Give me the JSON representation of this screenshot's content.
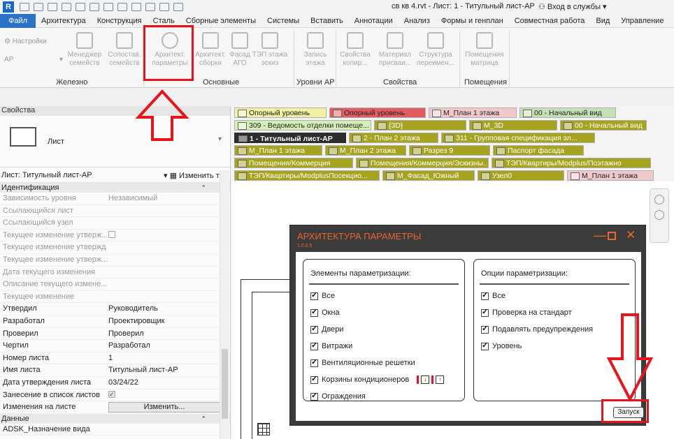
{
  "window": {
    "app_logo": "R",
    "title": "св кв 4.rvt - Лист: 1 - Титульный лист-АР",
    "signin": "Вход в службы"
  },
  "ribbon_tabs": [
    "Файл",
    "Архитектура",
    "Конструкция",
    "Сталь",
    "Сборные элементы",
    "Системы",
    "Вставить",
    "Аннотации",
    "Анализ",
    "Формы и генплан",
    "Совместная работа",
    "Вид",
    "Управление"
  ],
  "ribbon": {
    "settings_label": "Настройки",
    "ap_dropdown": "АР",
    "buttons": [
      {
        "line1": "Менеджер",
        "line2": "семейств"
      },
      {
        "line1": "Сопостав.",
        "line2": "семейств"
      },
      {
        "line1": "Архитект.",
        "line2": "параметры"
      },
      {
        "line1": "Архитект.",
        "line2": "сборки"
      },
      {
        "line1": "Фасад",
        "line2": "АГО"
      },
      {
        "line1": "ТЭП этажа",
        "line2": "эскиз"
      },
      {
        "line1": "Запись",
        "line2": "этажа"
      },
      {
        "line1": "Свойства",
        "line2": "копир..."
      },
      {
        "line1": "Материал",
        "line2": "присваи..."
      },
      {
        "line1": "Структура",
        "line2": "переимен..."
      },
      {
        "line1": "Помещения",
        "line2": "матрица"
      }
    ],
    "panels": [
      "Железно",
      "Основные",
      "Уровни АР",
      "Свойства",
      "Помещения"
    ]
  },
  "properties": {
    "title": "Свойства",
    "type_name": "Лист",
    "instance_label": "Лист: Титульный лист-АР",
    "edit_type": "Изменить тип",
    "cat_identity": "Идентификация",
    "cat_data": "Данные",
    "rows": [
      {
        "name": "Зависимость уровня",
        "value": "Независимый",
        "disabled": true
      },
      {
        "name": "Ссылающийся лист",
        "value": "",
        "disabled": true
      },
      {
        "name": "Ссылающийся узел",
        "value": "",
        "disabled": true
      },
      {
        "name": "Текущее изменение утверж...",
        "value": "",
        "disabled": true,
        "checkbox": true
      },
      {
        "name": "Текущее изменение утвержд...",
        "value": "",
        "disabled": true
      },
      {
        "name": "Текущее изменение утверж...",
        "value": "",
        "disabled": true
      },
      {
        "name": "Дата текущего изменения",
        "value": "",
        "disabled": true
      },
      {
        "name": "Описание текущего измене...",
        "value": "",
        "disabled": true
      },
      {
        "name": "Текущее изменение",
        "value": "",
        "disabled": true
      },
      {
        "name": "Утвердил",
        "value": "Руководитель",
        "disabled": false
      },
      {
        "name": "Разработал",
        "value": "Проектировщик",
        "disabled": false
      },
      {
        "name": "Проверил",
        "value": "Проверил",
        "disabled": false
      },
      {
        "name": "Чертил",
        "value": "Разработал",
        "disabled": false
      },
      {
        "name": "Номер листа",
        "value": "1",
        "disabled": false
      },
      {
        "name": "Имя листа",
        "value": "Титульный лист-АР",
        "disabled": false
      },
      {
        "name": "Дата утверждения листа",
        "value": "03/24/22",
        "disabled": false
      },
      {
        "name": "Занесение в список листов",
        "value": "",
        "disabled": false,
        "checkbox": true
      },
      {
        "name": "Изменения на листе",
        "value": "Изменить...",
        "disabled": false,
        "button": true
      }
    ],
    "data_rows": [
      {
        "name": "ADSK_Назначение вида",
        "value": ""
      }
    ]
  },
  "view_tabs": [
    "Опорный уровень",
    "Опорный уровень",
    "М_План 1 этажа",
    "00 - Начальный вид",
    "309 - Ведомость отделки помеще...",
    "{3D}",
    "М_3D",
    "00 - Начальный вид",
    "1 - Титульный лист-АР",
    "2 - План 2 этажа",
    "311 - Групповая спецификация эл...",
    "М_План 1 этажа",
    "М_План 2 этажа",
    "Разрез 9",
    "Паспорт фасада",
    "Помещения/Коммерция",
    "Помещения/Коммерция/Эскизны...",
    "ТЭП/Квартиры/Modplus/Поэтажно",
    "ТЭП/Квартиры/ModplusПосекцио...",
    "М_Фасад_Южный",
    "Узел0",
    "М_План 1 этажа"
  ],
  "dialog": {
    "title": "АРХИТЕКТУРА ПАРАМЕТРЫ",
    "version": "1.0.0.5",
    "left_title": "Элементы параметризации:",
    "left_items": [
      "Все",
      "Окна",
      "Двери",
      "Витражи",
      "Вентиляционные решетки",
      "Корзины кондиционеров",
      "Ограждения"
    ],
    "right_title": "Опции параметризации:",
    "right_items": [
      "Все",
      "Проверка на стандарт",
      "Подавлять предупреждения",
      "Уровень"
    ],
    "run_label": "Запуск"
  },
  "colors": {
    "annotation_red": "#e8131b",
    "dialog_accent": "#e9672d",
    "view_tab_olive": "#a6a41f"
  }
}
